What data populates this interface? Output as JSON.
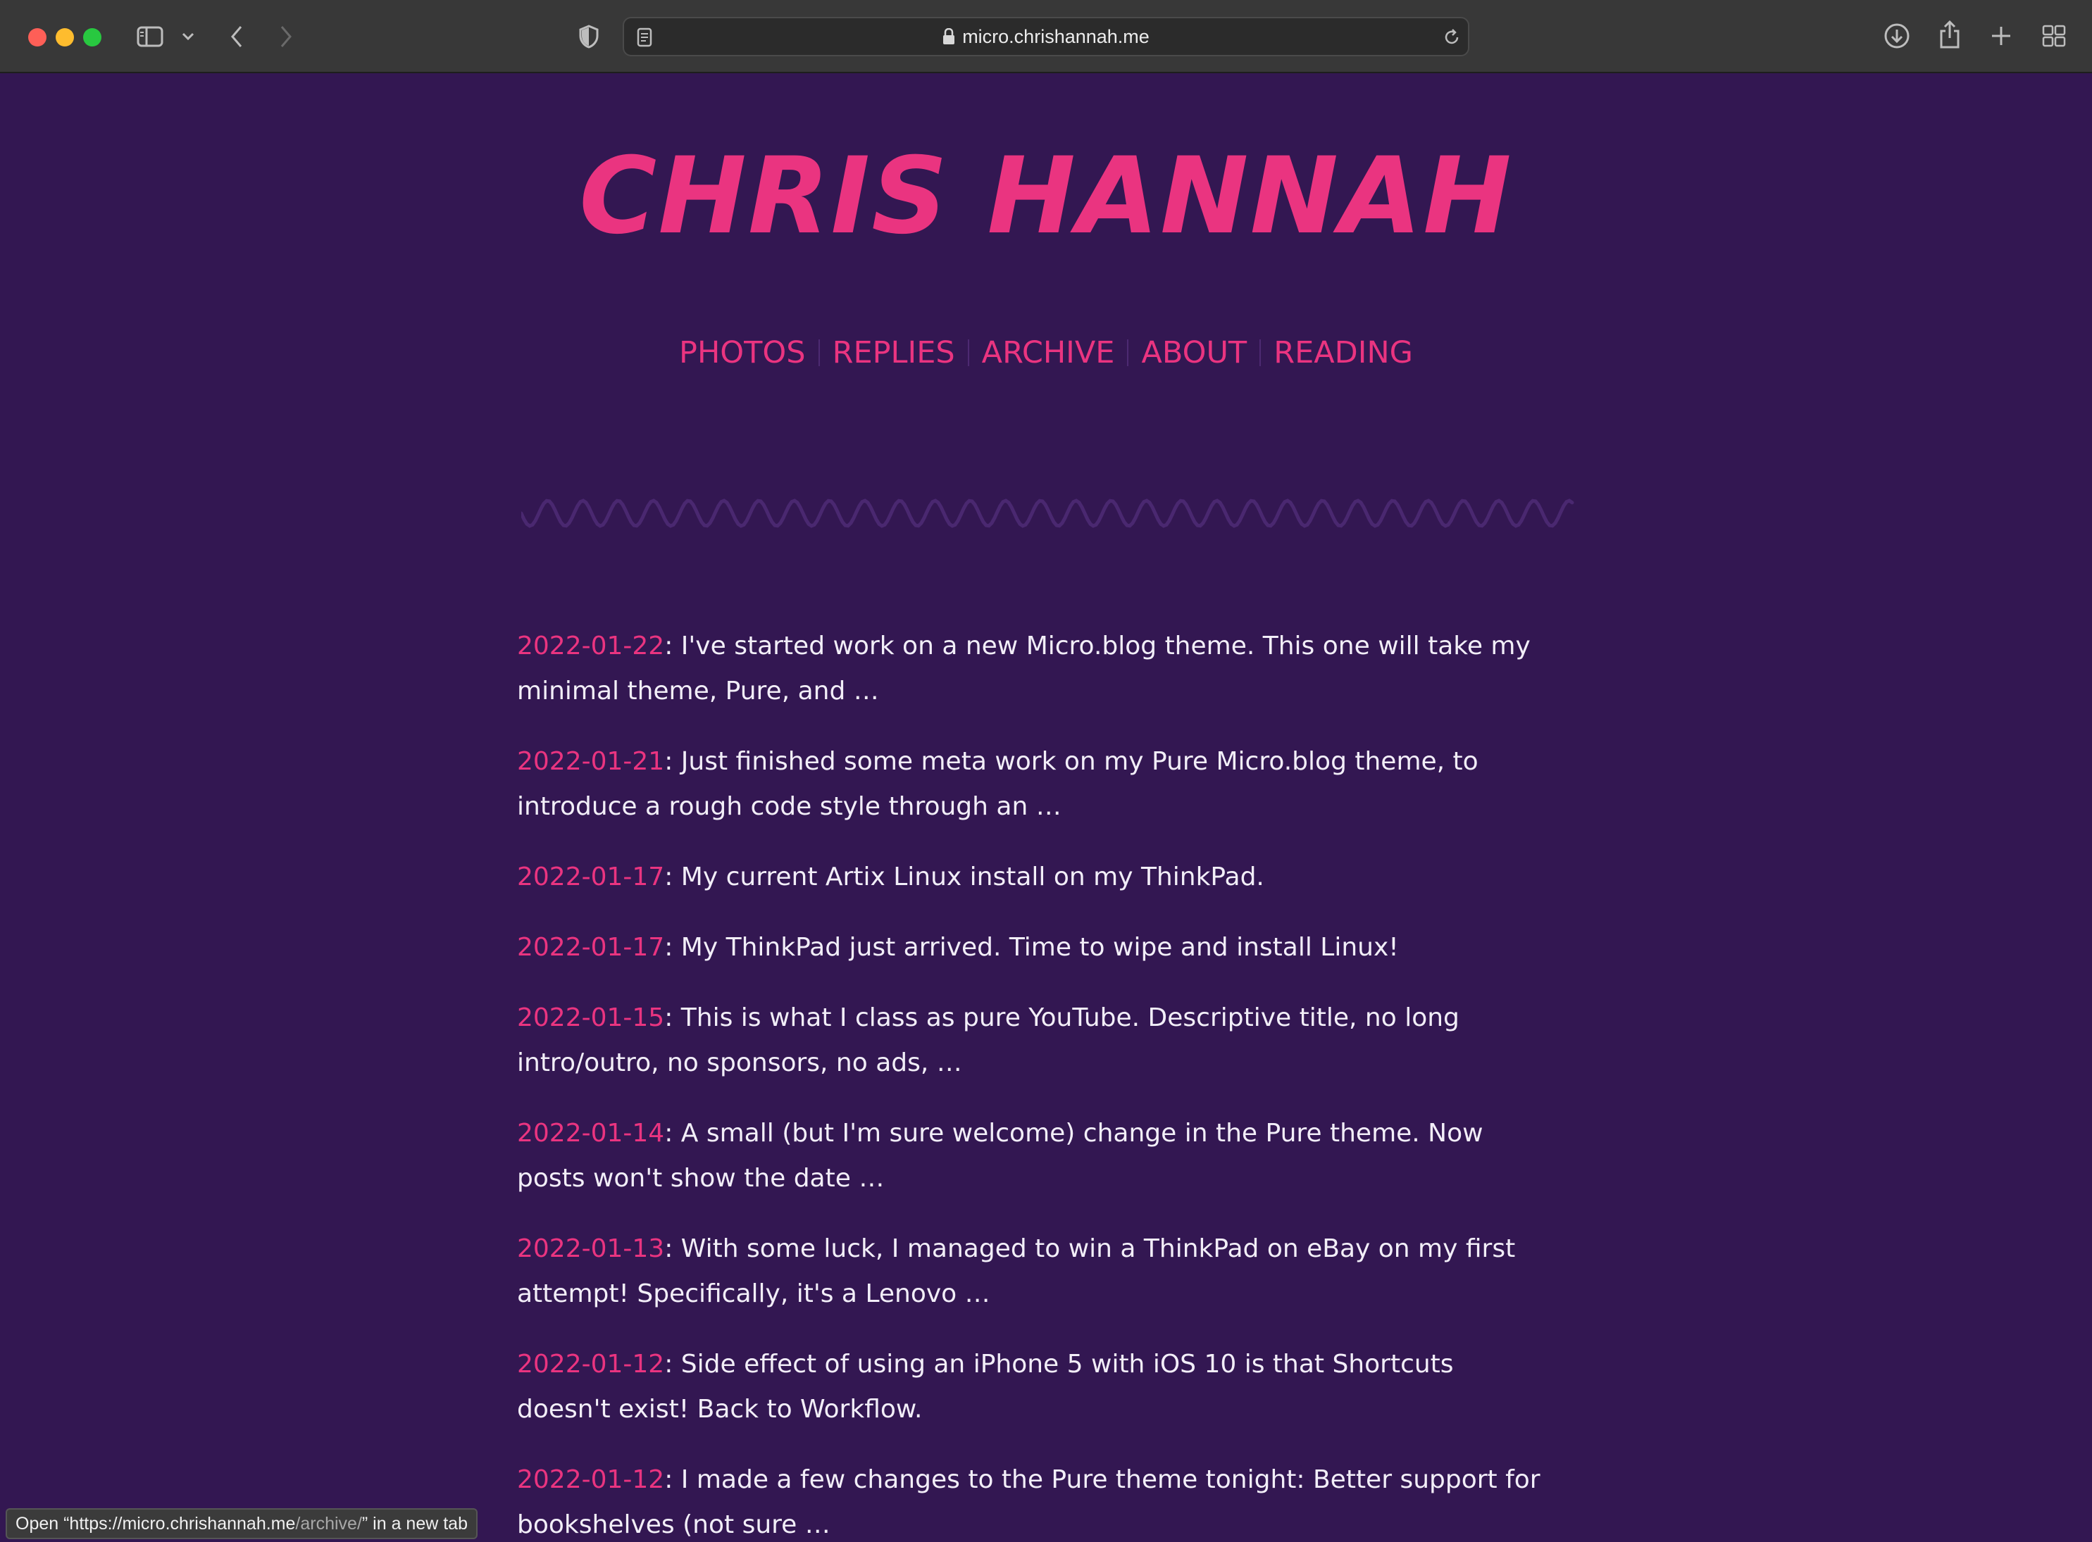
{
  "browser": {
    "url": "micro.chrishannah.me",
    "status_tip": {
      "prefix": "Open “https://micro.chrishannah.me",
      "path": "/archive/",
      "suffix": "” in a new tab"
    }
  },
  "site": {
    "title": "CHRIS HANNAH",
    "accent_color": "#ea3480",
    "background_color": "#331752"
  },
  "nav": {
    "items": [
      {
        "label": "PHOTOS"
      },
      {
        "label": "REPLIES"
      },
      {
        "label": "ARCHIVE"
      },
      {
        "label": "ABOUT"
      },
      {
        "label": "READING"
      }
    ]
  },
  "posts": [
    {
      "date": "2022-01-22",
      "text": ": I've started work on a new Micro.blog theme. This one will take my minimal theme, Pure, and …"
    },
    {
      "date": "2022-01-21",
      "text": ": Just finished some meta work on my Pure Micro.blog theme, to introduce a rough code style through an …"
    },
    {
      "date": "2022-01-17",
      "text": ": My current Artix Linux install on my ThinkPad."
    },
    {
      "date": "2022-01-17",
      "text": ": My ThinkPad just arrived. Time to wipe and install Linux!"
    },
    {
      "date": "2022-01-15",
      "text": ": This is what I class as pure YouTube. Descriptive title, no long intro/outro, no sponsors, no ads, …"
    },
    {
      "date": "2022-01-14",
      "text": ": A small (but I'm sure welcome) change in the Pure theme. Now posts won't show the date …"
    },
    {
      "date": "2022-01-13",
      "text": ": With some luck, I managed to win a ThinkPad on eBay on my first attempt! Specifically, it's a Lenovo …"
    },
    {
      "date": "2022-01-12",
      "text": ": Side effect of using an iPhone 5 with iOS 10 is that Shortcuts doesn't exist! Back to Workflow."
    },
    {
      "date": "2022-01-12",
      "text": ": I made a few changes to the Pure theme tonight: Better support for bookshelves (not sure …"
    }
  ]
}
